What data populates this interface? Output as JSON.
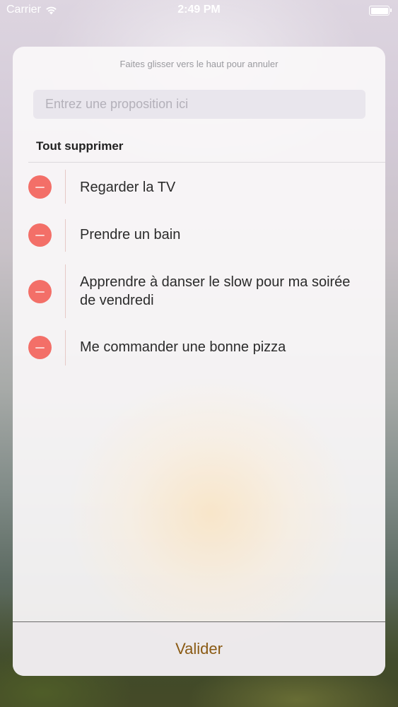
{
  "status_bar": {
    "carrier": "Carrier",
    "time": "2:49 PM",
    "wifi_icon": "wifi-icon",
    "battery_icon": "battery-icon"
  },
  "sheet": {
    "hint": "Faites glisser vers le haut pour annuler",
    "input_placeholder": "Entrez une proposition ici",
    "input_value": "",
    "delete_all_label": "Tout supprimer",
    "items": [
      {
        "label": "Regarder la TV",
        "icon": "remove-icon"
      },
      {
        "label": "Prendre un bain",
        "icon": "remove-icon"
      },
      {
        "label": "Apprendre à danser le slow pour ma soirée de vendredi",
        "icon": "remove-icon"
      },
      {
        "label": "Me commander une bonne pizza",
        "icon": "remove-icon"
      }
    ],
    "validate_label": "Valider"
  },
  "colors": {
    "remove_button": "#f36f68",
    "validate_text": "#8a5a13"
  }
}
